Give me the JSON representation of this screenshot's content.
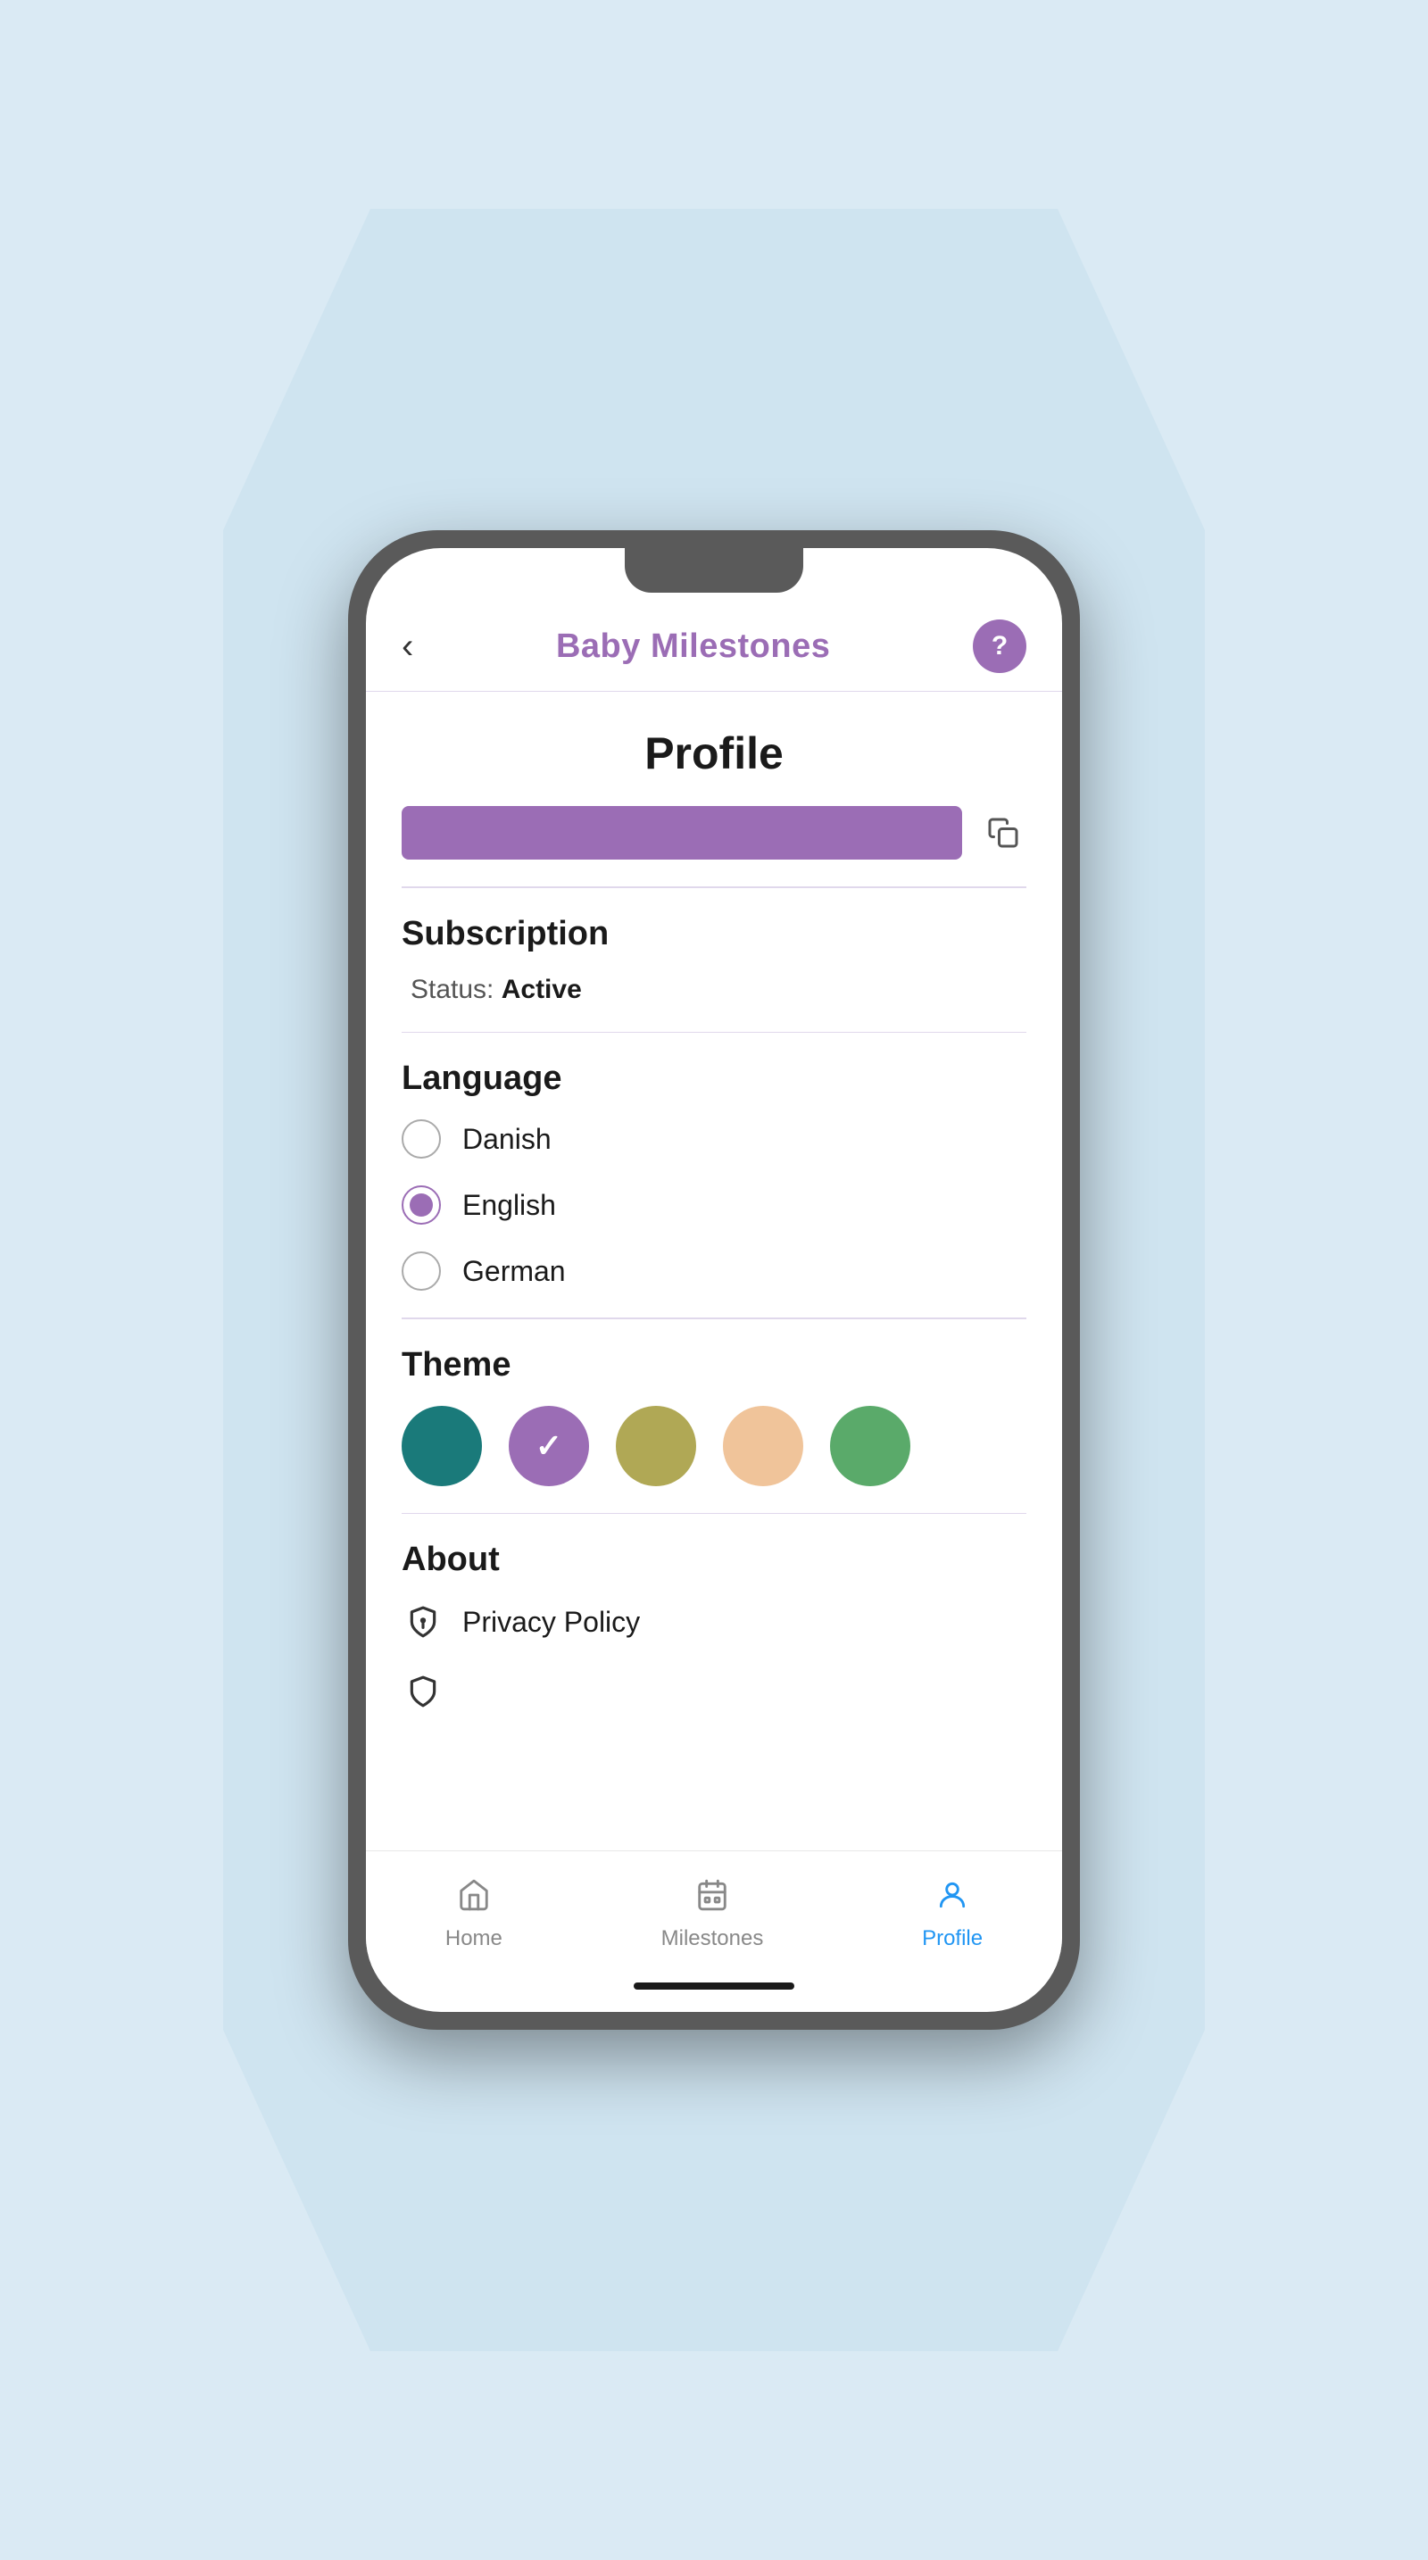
{
  "app": {
    "title": "Baby Milestones",
    "help_label": "?",
    "back_label": "‹"
  },
  "page": {
    "title": "Profile"
  },
  "code_bar": {
    "placeholder": ""
  },
  "subscription": {
    "section_title": "Subscription",
    "status_prefix": "Status: ",
    "status_value": "Active"
  },
  "language": {
    "section_title": "Language",
    "options": [
      {
        "label": "Danish",
        "selected": false
      },
      {
        "label": "English",
        "selected": true
      },
      {
        "label": "German",
        "selected": false
      }
    ]
  },
  "theme": {
    "section_title": "Theme",
    "colors": [
      "#1a7a7a",
      "#9b6db5",
      "#b0a855",
      "#f0c49a",
      "#5aaa6a"
    ],
    "selected_index": 1
  },
  "about": {
    "section_title": "About",
    "items": [
      {
        "label": "Privacy Policy",
        "icon": "shield"
      }
    ]
  },
  "bottom_nav": {
    "items": [
      {
        "label": "Home",
        "icon": "home",
        "active": false
      },
      {
        "label": "Milestones",
        "icon": "calendar",
        "active": false
      },
      {
        "label": "Profile",
        "icon": "person",
        "active": true
      }
    ]
  }
}
